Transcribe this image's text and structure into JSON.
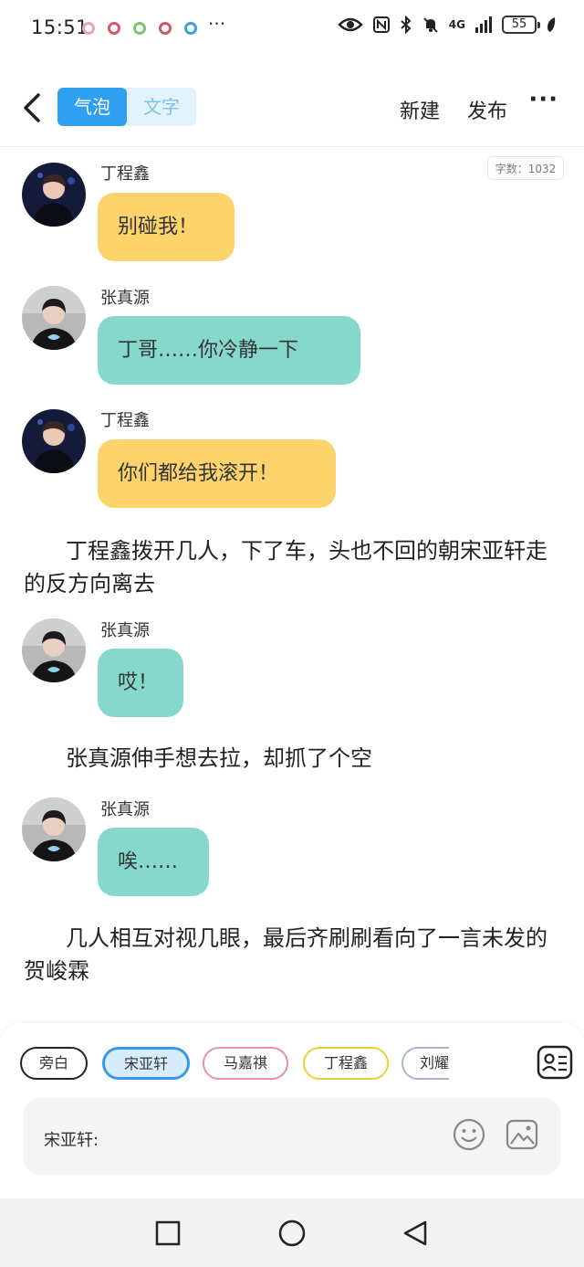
{
  "status_bar": {
    "time": "15:51",
    "more": "···",
    "network": "4G",
    "battery": "55",
    "notification_colors": [
      "#f2a0b0",
      "#d85a6a",
      "#7cc46a",
      "#c85a6a",
      "#3aa0e0"
    ]
  },
  "header": {
    "tabs": [
      {
        "label": "气泡",
        "active": true
      },
      {
        "label": "文字",
        "active": false
      }
    ],
    "new_label": "新建",
    "publish_label": "发布",
    "more_label": "···"
  },
  "word_count": "字数：1032",
  "messages": [
    {
      "type": "bubble",
      "speaker": "丁程鑫",
      "text": "别碰我！",
      "color": "#fdd46b"
    },
    {
      "type": "bubble",
      "speaker": "张真源",
      "text": "丁哥……你冷静一下",
      "color": "#86d8cd"
    },
    {
      "type": "bubble",
      "speaker": "丁程鑫",
      "text": "你们都给我滚开！",
      "color": "#fdd46b"
    },
    {
      "type": "narration",
      "text": "丁程鑫拨开几人，下了车，头也不回的朝宋亚轩走的反方向离去"
    },
    {
      "type": "bubble",
      "speaker": "张真源",
      "text": "哎！",
      "color": "#86d8cd"
    },
    {
      "type": "narration",
      "text": "张真源伸手想去拉，却抓了个空"
    },
    {
      "type": "bubble",
      "speaker": "张真源",
      "text": "唉……",
      "color": "#86d8cd"
    },
    {
      "type": "narration",
      "text": "几人相互对视几眼，最后齐刷刷看向了一言未发的贺峻霖"
    }
  ],
  "role_chips": [
    {
      "label": "旁白",
      "border": "#222222",
      "bg": "#ffffff"
    },
    {
      "label": "宋亚轩",
      "border": "#3a97e8",
      "bg": "#d8edfb"
    },
    {
      "label": "马嘉祺",
      "border": "#e88fb0",
      "bg": "#ffffff"
    },
    {
      "label": "丁程鑫",
      "border": "#f0cc3c",
      "bg": "#ffffff"
    },
    {
      "label": "刘耀",
      "border": "#a8b8cc",
      "bg": "#ffffff"
    }
  ],
  "input": {
    "label": "宋亚轩:"
  }
}
